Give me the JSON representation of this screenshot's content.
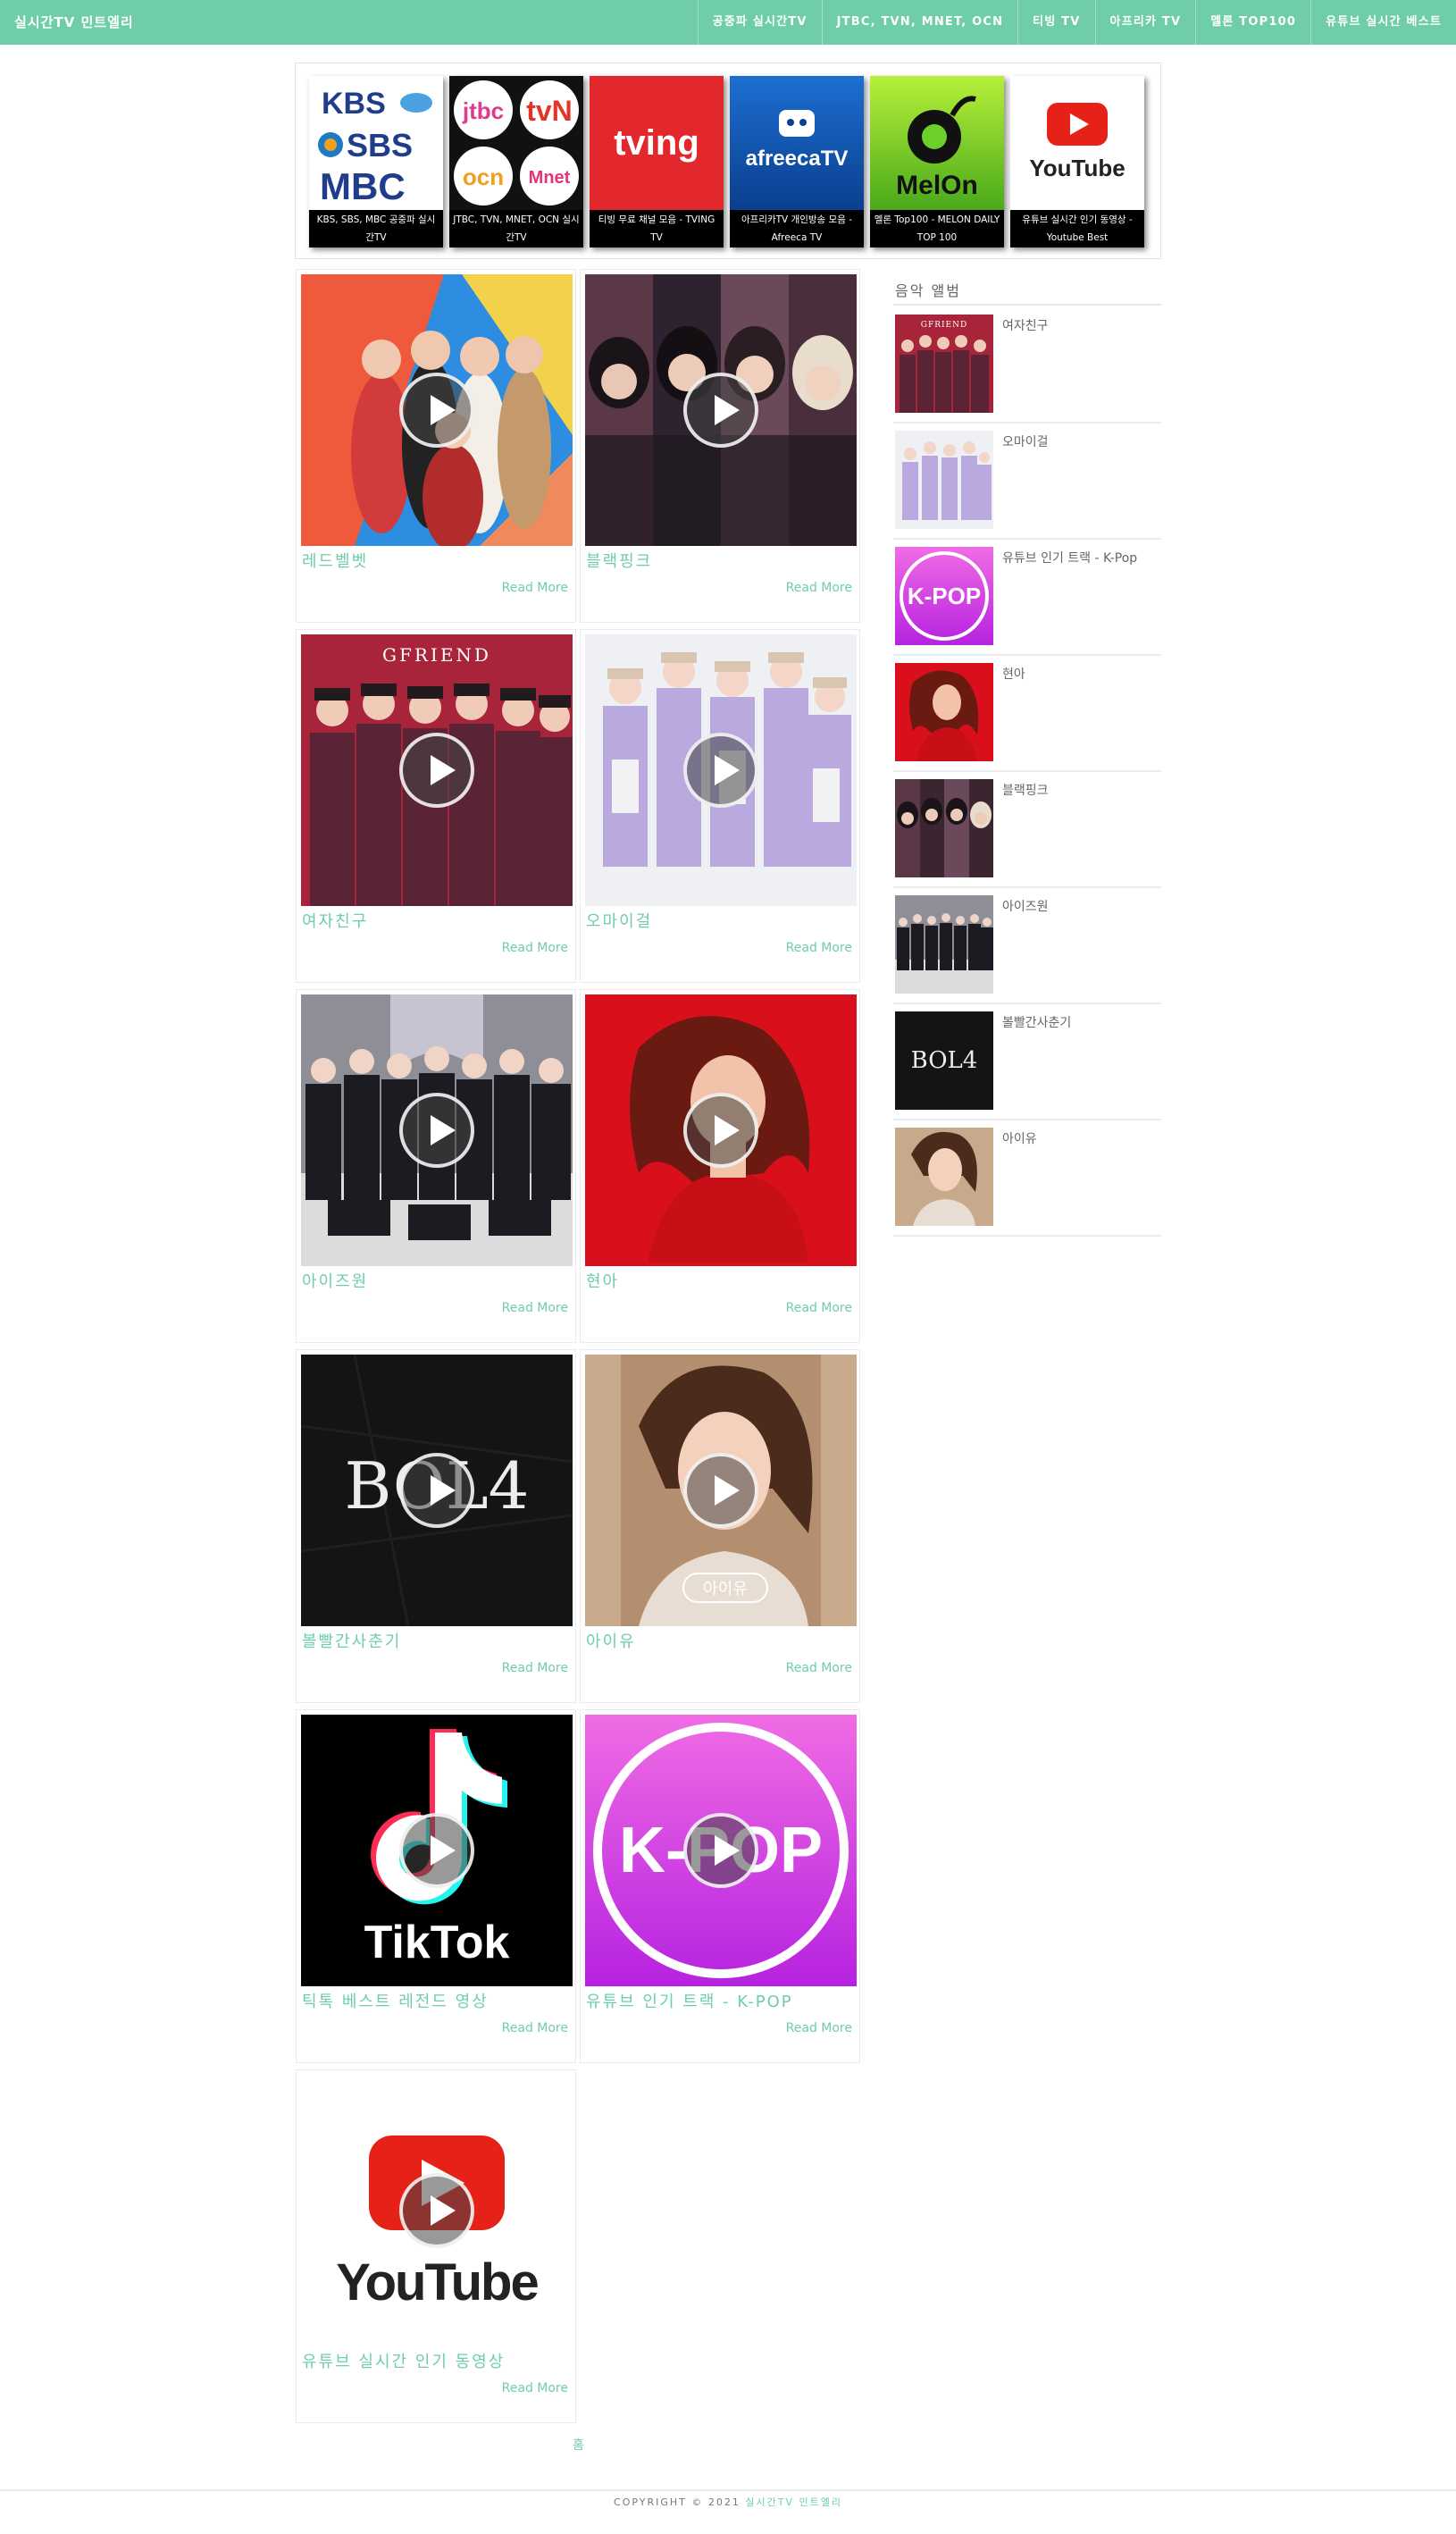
{
  "header": {
    "brand": "실시간TV 민트엘리",
    "nav": [
      "공중파 실시간TV",
      "JTBC, TVN, MNET, OCN",
      "티빙 TV",
      "아프리카 TV",
      "멜론 TOP100",
      "유튜브 실시간 베스트"
    ]
  },
  "channels": [
    {
      "logo": "KBS SBS MBC",
      "caption": "KBS, SBS, MBC 공중파 실시간TV"
    },
    {
      "logo": "JTBC tvN OCN Mnet",
      "caption": "JTBC, TVN, MNET, OCN 실시간TV"
    },
    {
      "logo": "tving",
      "caption": "티빙 무료 채널 모음 - TVING TV"
    },
    {
      "logo": "afreecaTV",
      "caption": "아프리카TV 개인방송 모음 - Afreeca TV"
    },
    {
      "logo": "MelOn",
      "caption": "멜론 Top100 - MELON DAILY TOP 100"
    },
    {
      "logo": "YouTube",
      "caption": "유튜브 실시간 인기 동영상 - Youtube Best"
    }
  ],
  "posts": [
    {
      "title": "레드벨벳",
      "more": "Read More"
    },
    {
      "title": "블랙핑크",
      "more": "Read More"
    },
    {
      "title": "여자친구",
      "more": "Read More",
      "thumb_text": "GFRIEND"
    },
    {
      "title": "오마이걸",
      "more": "Read More"
    },
    {
      "title": "아이즈원",
      "more": "Read More"
    },
    {
      "title": "현아",
      "more": "Read More"
    },
    {
      "title": "볼빨간사춘기",
      "more": "Read More",
      "thumb_text": "BOL4"
    },
    {
      "title": "아이유",
      "more": "Read More",
      "thumb_text": "아이유"
    },
    {
      "title": "틱톡 베스트 레전드 영상",
      "more": "Read More",
      "thumb_text": "TikTok"
    },
    {
      "title": "유튜브 인기 트랙 - K-POP",
      "more": "Read More",
      "thumb_text": "K-POP"
    },
    {
      "title": "유튜브 실시간 인기 동영상",
      "more": "Read More",
      "thumb_text": "YouTube"
    }
  ],
  "sidebar": {
    "title": "음악 앨범",
    "items": [
      {
        "title": "여자친구",
        "thumb_text": "GFRIEND"
      },
      {
        "title": "오마이걸"
      },
      {
        "title": "유튜브 인기 트랙 - K-Pop",
        "thumb_text": "K-POP"
      },
      {
        "title": "현아"
      },
      {
        "title": "블랙핑크"
      },
      {
        "title": "아이즈원"
      },
      {
        "title": "볼빨간사춘기",
        "thumb_text": "BOL4"
      },
      {
        "title": "아이유"
      }
    ]
  },
  "pager": "홈",
  "footer": {
    "prefix": "COPYRIGHT © 2021",
    "link": "실시간TV 민트엘리"
  },
  "colors": {
    "accent": "#6fcda9"
  }
}
